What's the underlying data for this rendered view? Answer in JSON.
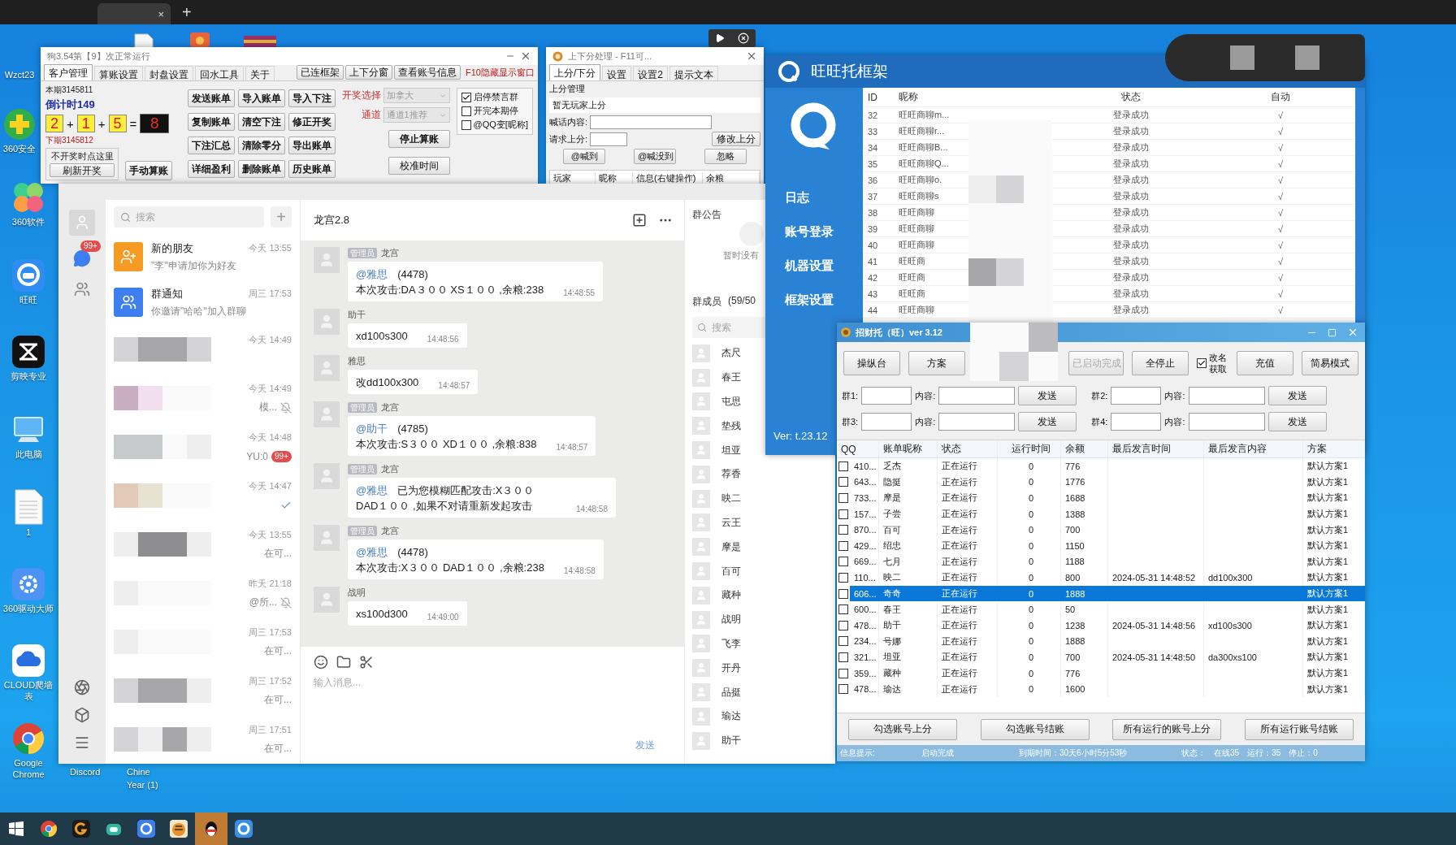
{
  "browser_bar": {
    "tab_close": "×",
    "new_tab": "+"
  },
  "desktop_icons": [
    {
      "kind": "label_only",
      "label": "Wzct23"
    },
    {
      "kind": "shield",
      "label": "360安全"
    },
    {
      "kind": "apps",
      "label": "360软件"
    },
    {
      "kind": "wangwang",
      "label": "旺旺"
    },
    {
      "kind": "capcut",
      "label": "剪映专业"
    },
    {
      "kind": "pc",
      "label": "此电脑"
    },
    {
      "kind": "file",
      "label": "1"
    },
    {
      "kind": "driver",
      "label": "360驱动大师"
    },
    {
      "kind": "cloud",
      "label": "CLOUD爬墙表"
    },
    {
      "kind": "chrome",
      "label": "Google Chrome"
    }
  ],
  "desktop_labels": [
    "Discord",
    "Chine",
    "Year (1)"
  ],
  "calc_window": {
    "title": "狗3.54第【9】次正常运行",
    "tabs": [
      {
        "label": "客户管理",
        "selected": true
      },
      {
        "label": "算账设置",
        "selected": false
      },
      {
        "label": "封盘设置",
        "selected": false
      },
      {
        "label": "回水工具",
        "selected": false
      },
      {
        "label": "关于",
        "selected": false
      }
    ],
    "top_buttons": [
      "已连框架",
      "上下分窗",
      "查看账号信息"
    ],
    "hide_hint": "F10隐藏显示窗口",
    "current_period": "本期3145811",
    "countdown": "倒计时149",
    "dice": [
      "2",
      "1",
      "5"
    ],
    "operators": [
      "+",
      "+",
      "="
    ],
    "sum": "8",
    "next_period": "下期3145812",
    "group_label": "不开奖时点这里",
    "refresh_button": "刷新开奖",
    "manual_button": "手动算账",
    "grid_buttons": [
      "发送账单",
      "导入账单",
      "导入下注",
      "复制账单",
      "清空下注",
      "修正开奖",
      "下注汇总",
      "清除零分",
      "导出账单",
      "详细盈利",
      "删除账单",
      "历史账单"
    ],
    "draw_select": {
      "label": "开奖选择",
      "value": "加拿大"
    },
    "channel_select": {
      "label": "通道",
      "value": "通道1推荐"
    },
    "stop_button": "停止算账",
    "calibrate_button": "校准时间",
    "checkboxes": [
      {
        "label": "启停禁言群",
        "checked": true
      },
      {
        "label": "开完本期停",
        "checked": false
      },
      {
        "label": "@QQ变[昵称]",
        "checked": false
      }
    ]
  },
  "updown_window": {
    "title": "上下分处理 - F11可...",
    "tabs": [
      {
        "label": "上分/下分",
        "selected": true
      },
      {
        "label": "设置",
        "selected": false
      },
      {
        "label": "设置2",
        "selected": false
      },
      {
        "label": "提示文本",
        "selected": false
      }
    ],
    "section": "上分管理",
    "notice": "暂无玩家上分",
    "shout_label": "喊话内容:",
    "request_label": "请求上分:",
    "modify_button": "修改上分",
    "action_buttons": [
      "@喊到",
      "@喊没到",
      "忽略"
    ],
    "columns": [
      "玩家",
      "昵称",
      "信息(右键操作)",
      "余粮"
    ]
  },
  "chat": {
    "rail_badge": "99+",
    "search_placeholder": "搜索",
    "add": "+",
    "conversations": [
      {
        "kind": "contact",
        "title": "新的朋友",
        "time": "今天 13:55",
        "preview": "\"李\"申请加你为好友",
        "color": "#f59a23",
        "muted": false,
        "read": false
      },
      {
        "kind": "contact",
        "title": "群通知",
        "time": "周三 17:53",
        "preview": "你邀请\"哈哈\"加入群聊",
        "color": "#3d7ff0",
        "muted": false,
        "read": false
      },
      {
        "kind": "blurred",
        "time": "今天 14:49",
        "muted": false,
        "read": false
      },
      {
        "kind": "blurred",
        "time": "今天 14:49",
        "preview": "模...",
        "muted": true,
        "read": false
      },
      {
        "kind": "blurred",
        "time": "今天 14:48",
        "preview": "YU:0",
        "badge": "99+",
        "muted": false,
        "read": false
      },
      {
        "kind": "blurred",
        "time": "今天 14:47",
        "muted": false,
        "read": true
      },
      {
        "kind": "blurred",
        "time": "今天 13:55",
        "preview": "在可...",
        "muted": false,
        "read": false
      },
      {
        "kind": "blurred",
        "time": "昨天 21:18",
        "preview": "@所...",
        "muted": true,
        "read": false
      },
      {
        "kind": "blurred",
        "time": "周三 17:53",
        "preview": "在可...",
        "muted": false,
        "read": false
      },
      {
        "kind": "blurred",
        "time": "周三 17:52",
        "preview": "在可...",
        "muted": false,
        "read": false
      },
      {
        "kind": "blurred",
        "time": "周三 17:51",
        "preview": "在可...",
        "muted": false,
        "read": false
      }
    ],
    "chat_title": "龙宫2.8",
    "messages": [
      {
        "role": "管理员",
        "sender": "龙宫",
        "mention": "@雅思",
        "lines": [
          "(4478)",
          "本次攻击:DA３００ XS１００ ,余粮:238"
        ],
        "time": "14:48:55"
      },
      {
        "sender": "助干",
        "lines": [
          "xd100s300"
        ],
        "time": "14:48:56"
      },
      {
        "sender": "雅思",
        "lines": [
          "改dd100x300"
        ],
        "time": "14:48:57"
      },
      {
        "role": "管理员",
        "sender": "龙宫",
        "mention": "@助干",
        "lines": [
          "(4785)",
          "本次攻击:S３００ XD１００ ,余粮:838"
        ],
        "time": "14:48:57"
      },
      {
        "role": "管理员",
        "sender": "龙宫",
        "mention": "@雅思",
        "lines": [
          "已为您模糊匹配攻击:X３００ DAD１００ ,如果不对请重新发起攻击"
        ],
        "time": "14:48:58"
      },
      {
        "role": "管理员",
        "sender": "龙宫",
        "mention": "@雅思",
        "lines": [
          "(4478)",
          "本次攻击:X３００ DAD１００ ,余粮:238"
        ],
        "time": "14:48:58"
      },
      {
        "sender": "战明",
        "lines": [
          "xs100d300"
        ],
        "time": "14:49:00"
      }
    ],
    "input_placeholder": "输入消息...",
    "send_button": "发送",
    "announcement_title": "群公告",
    "announcement_empty": "暂时没有",
    "members_title": "群成员",
    "members_count": "(59/50",
    "member_search": "搜索",
    "members": [
      "杰尺",
      "春王",
      "屯思",
      "垫残",
      "坦亚",
      "荐香",
      "映二",
      "云王",
      "摩是",
      "百可",
      "藏种",
      "战明",
      "飞李",
      "开丹",
      "品挺",
      "瑜达",
      "助干"
    ]
  },
  "wangwang": {
    "title": "旺旺托框架",
    "nav": [
      "日志",
      "账号登录",
      "机器设置",
      "框架设置"
    ],
    "version": "Ver: t.23.12",
    "columns": [
      "ID",
      "昵称",
      "状态",
      "自动"
    ],
    "rows": [
      {
        "id": "32",
        "name": "旺旺商聊m...",
        "status": "登录成功",
        "auto": "√"
      },
      {
        "id": "33",
        "name": "旺旺商聊r...",
        "status": "登录成功",
        "auto": "√"
      },
      {
        "id": "34",
        "name": "旺旺商聊B...",
        "status": "登录成功",
        "auto": "√"
      },
      {
        "id": "35",
        "name": "旺旺商聊Q...",
        "status": "登录成功",
        "auto": "√"
      },
      {
        "id": "36",
        "name": "旺旺商聊o.",
        "status": "登录成功",
        "auto": "√"
      },
      {
        "id": "37",
        "name": "旺旺商聊s",
        "status": "登录成功",
        "auto": "√"
      },
      {
        "id": "38",
        "name": "旺旺商聊",
        "status": "登录成功",
        "auto": "√"
      },
      {
        "id": "39",
        "name": "旺旺商聊",
        "status": "登录成功",
        "auto": "√"
      },
      {
        "id": "40",
        "name": "旺旺商聊",
        "status": "登录成功",
        "auto": "√"
      },
      {
        "id": "41",
        "name": "旺旺商",
        "status": "登录成功",
        "auto": "√"
      },
      {
        "id": "42",
        "name": "旺旺商",
        "status": "登录成功",
        "auto": "√"
      },
      {
        "id": "43",
        "name": "旺旺商",
        "status": "登录成功",
        "auto": "√"
      },
      {
        "id": "44",
        "name": "旺旺商聊",
        "status": "登录成功",
        "auto": "√"
      }
    ]
  },
  "zhaocai": {
    "title": "招财托（旺）ver 3.12",
    "toolbar": [
      {
        "kind": "button",
        "label": "操纵台",
        "disabled": false
      },
      {
        "kind": "button",
        "label": "方案",
        "disabled": false
      },
      {
        "kind": "button",
        "label": "已启动完成",
        "disabled": true
      },
      {
        "kind": "button",
        "label": "全停止",
        "disabled": false
      },
      {
        "kind": "checkbox",
        "label": "改名获取",
        "checked": true
      },
      {
        "kind": "button",
        "label": "充值",
        "disabled": false
      },
      {
        "kind": "button",
        "label": "简易模式",
        "disabled": false
      }
    ],
    "groups": [
      {
        "label": "群1:",
        "content_label": "内容:",
        "send": "发送"
      },
      {
        "label": "群2:",
        "content_label": "内容:",
        "send": "发送"
      },
      {
        "label": "群3:",
        "content_label": "内容:",
        "send": "发送"
      },
      {
        "label": "群4:",
        "content_label": "内容:",
        "send": "发送"
      }
    ],
    "columns": [
      "QQ",
      "账单昵称",
      "状态",
      "运行时间",
      "余额",
      "最后发言时间",
      "最后发言内容",
      "方案"
    ],
    "rows": [
      {
        "checked": false,
        "selected": false,
        "qq": "410...",
        "name": "乏杰",
        "status": "正在运行",
        "runtime": "0",
        "balance": "776",
        "plan": "默认方案1"
      },
      {
        "checked": false,
        "selected": false,
        "qq": "643...",
        "name": "隐挺",
        "status": "正在运行",
        "runtime": "0",
        "balance": "1776",
        "plan": "默认方案1"
      },
      {
        "checked": false,
        "selected": false,
        "qq": "733...",
        "name": "摩是",
        "status": "正在运行",
        "runtime": "0",
        "balance": "1688",
        "plan": "默认方案1"
      },
      {
        "checked": false,
        "selected": false,
        "qq": "157...",
        "name": "子尝",
        "status": "正在运行",
        "runtime": "0",
        "balance": "1388",
        "plan": "默认方案1"
      },
      {
        "checked": false,
        "selected": false,
        "qq": "870...",
        "name": "百可",
        "status": "正在运行",
        "runtime": "0",
        "balance": "700",
        "plan": "默认方案1"
      },
      {
        "checked": false,
        "selected": false,
        "qq": "429...",
        "name": "绍忠",
        "status": "正在运行",
        "runtime": "0",
        "balance": "1150",
        "plan": "默认方案1"
      },
      {
        "checked": false,
        "selected": false,
        "qq": "669...",
        "name": "七月",
        "status": "正在运行",
        "runtime": "0",
        "balance": "1188",
        "plan": "默认方案1"
      },
      {
        "checked": false,
        "selected": false,
        "qq": "110...",
        "name": "映二",
        "status": "正在运行",
        "runtime": "0",
        "balance": "800",
        "last_time": "2024-05-31 14:48:52",
        "last_content": "dd100x300",
        "plan": "默认方案1"
      },
      {
        "checked": false,
        "selected": true,
        "qq": "606...",
        "name": "奇奇",
        "status": "正在运行",
        "runtime": "0",
        "balance": "1888",
        "plan": "默认方案1"
      },
      {
        "checked": false,
        "selected": false,
        "qq": "600...",
        "name": "春王",
        "status": "正在运行",
        "runtime": "0",
        "balance": "50",
        "plan": "默认方案1"
      },
      {
        "checked": false,
        "selected": false,
        "qq": "478...",
        "name": "助干",
        "status": "正在运行",
        "runtime": "0",
        "balance": "1238",
        "last_time": "2024-05-31 14:48:56",
        "last_content": "xd100s300",
        "plan": "默认方案1"
      },
      {
        "checked": false,
        "selected": false,
        "qq": "234...",
        "name": "号娜",
        "status": "正在运行",
        "runtime": "0",
        "balance": "1888",
        "plan": "默认方案1"
      },
      {
        "checked": false,
        "selected": false,
        "qq": "321...",
        "name": "坦亚",
        "status": "正在运行",
        "runtime": "0",
        "balance": "700",
        "last_time": "2024-05-31 14:48:50",
        "last_content": "da300xs100",
        "plan": "默认方案1"
      },
      {
        "checked": false,
        "selected": false,
        "qq": "359...",
        "name": "藏种",
        "status": "正在运行",
        "runtime": "0",
        "balance": "776",
        "plan": "默认方案1"
      },
      {
        "checked": false,
        "selected": false,
        "qq": "478...",
        "name": "瑜达",
        "status": "正在运行",
        "runtime": "0",
        "balance": "1600",
        "plan": "默认方案1"
      }
    ],
    "bottom_buttons": [
      "勾选账号上分",
      "勾选账号结账",
      "所有运行的账号上分",
      "所有运行账号结账"
    ],
    "status": {
      "info_label": "信息提示:",
      "info": "启动完成",
      "expiry": "到期时间：30天6小时5分53秒",
      "state_label": "状态：",
      "online": "在线35",
      "running": "运行：35",
      "stopped": "停止：0"
    }
  },
  "taskbar": {
    "items": [
      {
        "kind": "start",
        "selected": false
      },
      {
        "kind": "chrome",
        "selected": false
      },
      {
        "kind": "ring",
        "selected": false
      },
      {
        "kind": "robot",
        "selected": false
      },
      {
        "kind": "bubble",
        "selected": false
      },
      {
        "kind": "tiger",
        "selected": false
      },
      {
        "kind": "penguin",
        "selected": true
      },
      {
        "kind": "wangwang",
        "selected": false
      }
    ]
  }
}
